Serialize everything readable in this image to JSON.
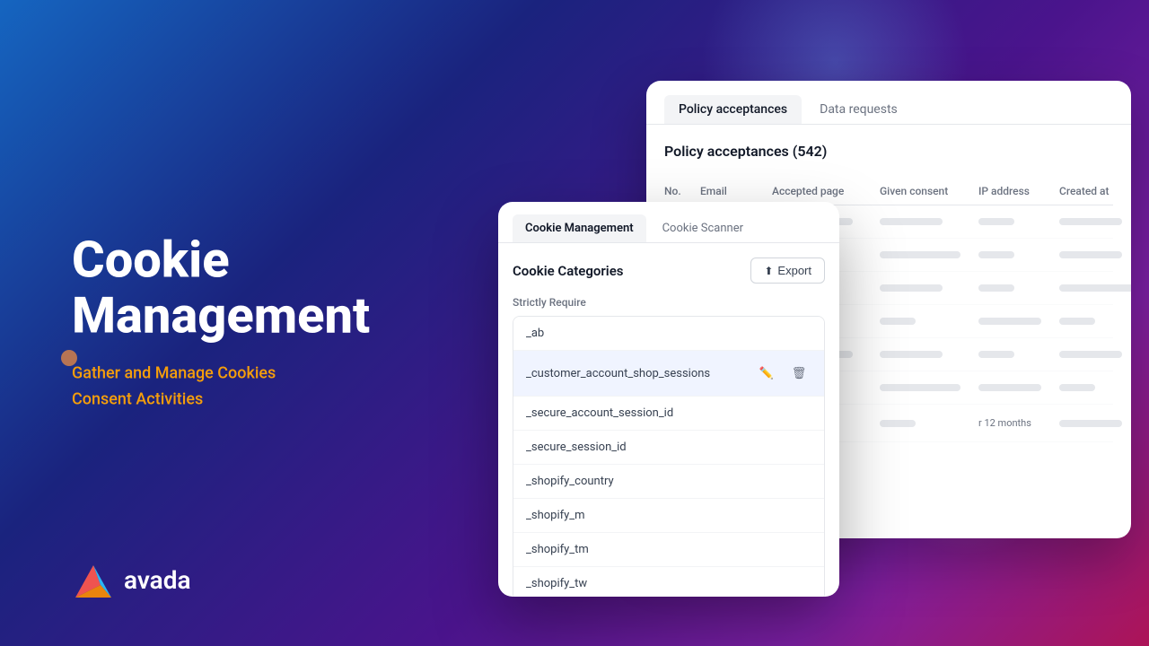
{
  "background": {
    "gradient_start": "#1565c0",
    "gradient_end": "#ad1457"
  },
  "left": {
    "title_line1": "Cookie",
    "title_line2": "Management",
    "subtitle_line1": "Gather and Manage Cookies",
    "subtitle_line2": "Consent Activities"
  },
  "logo": {
    "text": "avada"
  },
  "policy_panel": {
    "tab_active": "Policy acceptances",
    "tab_inactive": "Data requests",
    "heading": "Policy acceptances (542)",
    "columns": [
      "No.",
      "Email",
      "Accepted page",
      "Given consent",
      "IP address",
      "Created at"
    ],
    "rows": [
      {
        "no": "",
        "email": "",
        "page": "",
        "consent": "",
        "ip": "",
        "created": ""
      },
      {
        "no": "",
        "email": "",
        "page": "",
        "consent": "",
        "ip": "",
        "created": ""
      },
      {
        "no": "",
        "email": "",
        "page": "",
        "consent": "",
        "ip": "",
        "created": ""
      },
      {
        "no": "",
        "email": "",
        "page": "",
        "consent": "",
        "ip": "",
        "created": ""
      },
      {
        "no": "",
        "email": "",
        "page": "",
        "consent": "",
        "ip": "",
        "created": ""
      },
      {
        "no": "",
        "email": "",
        "page": "",
        "consent": "",
        "ip": "",
        "created": ""
      },
      {
        "no": "",
        "email": "",
        "page": "",
        "consent": "",
        "ip": "r 12 months",
        "created": ""
      }
    ]
  },
  "cookie_panel": {
    "tab_active": "Cookie Management",
    "tab_inactive": "Cookie Scanner",
    "categories_title": "Cookie Categories",
    "export_label": "Export",
    "section_label": "Strictly Require",
    "cookies": [
      {
        "name": "_ab",
        "highlighted": false
      },
      {
        "name": "_customer_account_shop_sessions",
        "highlighted": true
      },
      {
        "name": "_secure_account_session_id",
        "highlighted": false
      },
      {
        "name": "_secure_session_id",
        "highlighted": false
      },
      {
        "name": "_shopify_country",
        "highlighted": false
      },
      {
        "name": "_shopify_m",
        "highlighted": false
      },
      {
        "name": "_shopify_tm",
        "highlighted": false
      },
      {
        "name": "_shopify_tw",
        "highlighted": false
      }
    ]
  }
}
